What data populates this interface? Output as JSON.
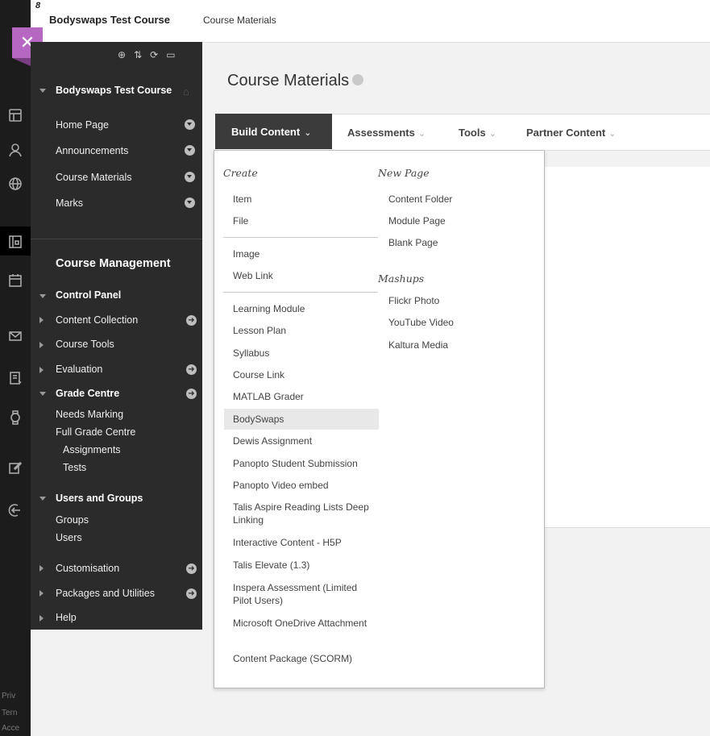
{
  "header": {
    "course_title": "Bodyswaps Test Course",
    "breadcrumb": "Course Materials"
  },
  "global_nav": {
    "footer": [
      "Priv",
      "Tern",
      "Acce"
    ]
  },
  "close_button": {
    "label": "✕"
  },
  "course_menu": {
    "tool_icons": [
      "⊕",
      "⇅",
      "⟳",
      "▭"
    ],
    "course_name": "Bodyswaps Test Course",
    "links": [
      "Home Page",
      "Announcements",
      "Course Materials",
      "Marks"
    ],
    "management_title": "Course Management",
    "control_panel": "Control Panel",
    "control_items": {
      "content_collection": "Content Collection",
      "course_tools": "Course Tools",
      "evaluation": "Evaluation",
      "grade_centre": "Grade Centre",
      "needs_marking": "Needs Marking",
      "full_grade_centre": "Full Grade Centre",
      "assignments": "Assignments",
      "tests": "Tests",
      "users_and_groups": "Users and Groups",
      "groups": "Groups",
      "users": "Users",
      "customisation": "Customisation",
      "packages_and_utilities": "Packages and Utilities",
      "help": "Help"
    }
  },
  "page": {
    "title": "Course Materials"
  },
  "action_bar": {
    "build_content": "Build Content",
    "assessments": "Assessments",
    "tools": "Tools",
    "partner_content": "Partner Content",
    "chevron": "⌄"
  },
  "dropdown": {
    "create_heading": "Create",
    "create_group1": [
      "Item",
      "File"
    ],
    "create_group2": [
      "Image",
      "Web Link"
    ],
    "create_group3": [
      "Learning Module",
      "Lesson Plan",
      "Syllabus",
      "Course Link",
      "MATLAB Grader",
      "BodySwaps",
      "Dewis Assignment",
      "Panopto Student Submission",
      "Panopto Video embed",
      "Talis Aspire Reading Lists Deep Linking",
      "Interactive Content - H5P",
      "Talis Elevate (1.3)",
      "Inspera Assessment (Limited Pilot Users)",
      "Microsoft OneDrive Attachment",
      "Content Package (SCORM)"
    ],
    "highlighted": "BodySwaps",
    "new_page_heading": "New Page",
    "new_page_items": [
      "Content Folder",
      "Module Page",
      "Blank Page"
    ],
    "mashups_heading": "Mashups",
    "mashups_items": [
      "Flickr Photo",
      "YouTube Video",
      "Kaltura Media"
    ]
  }
}
